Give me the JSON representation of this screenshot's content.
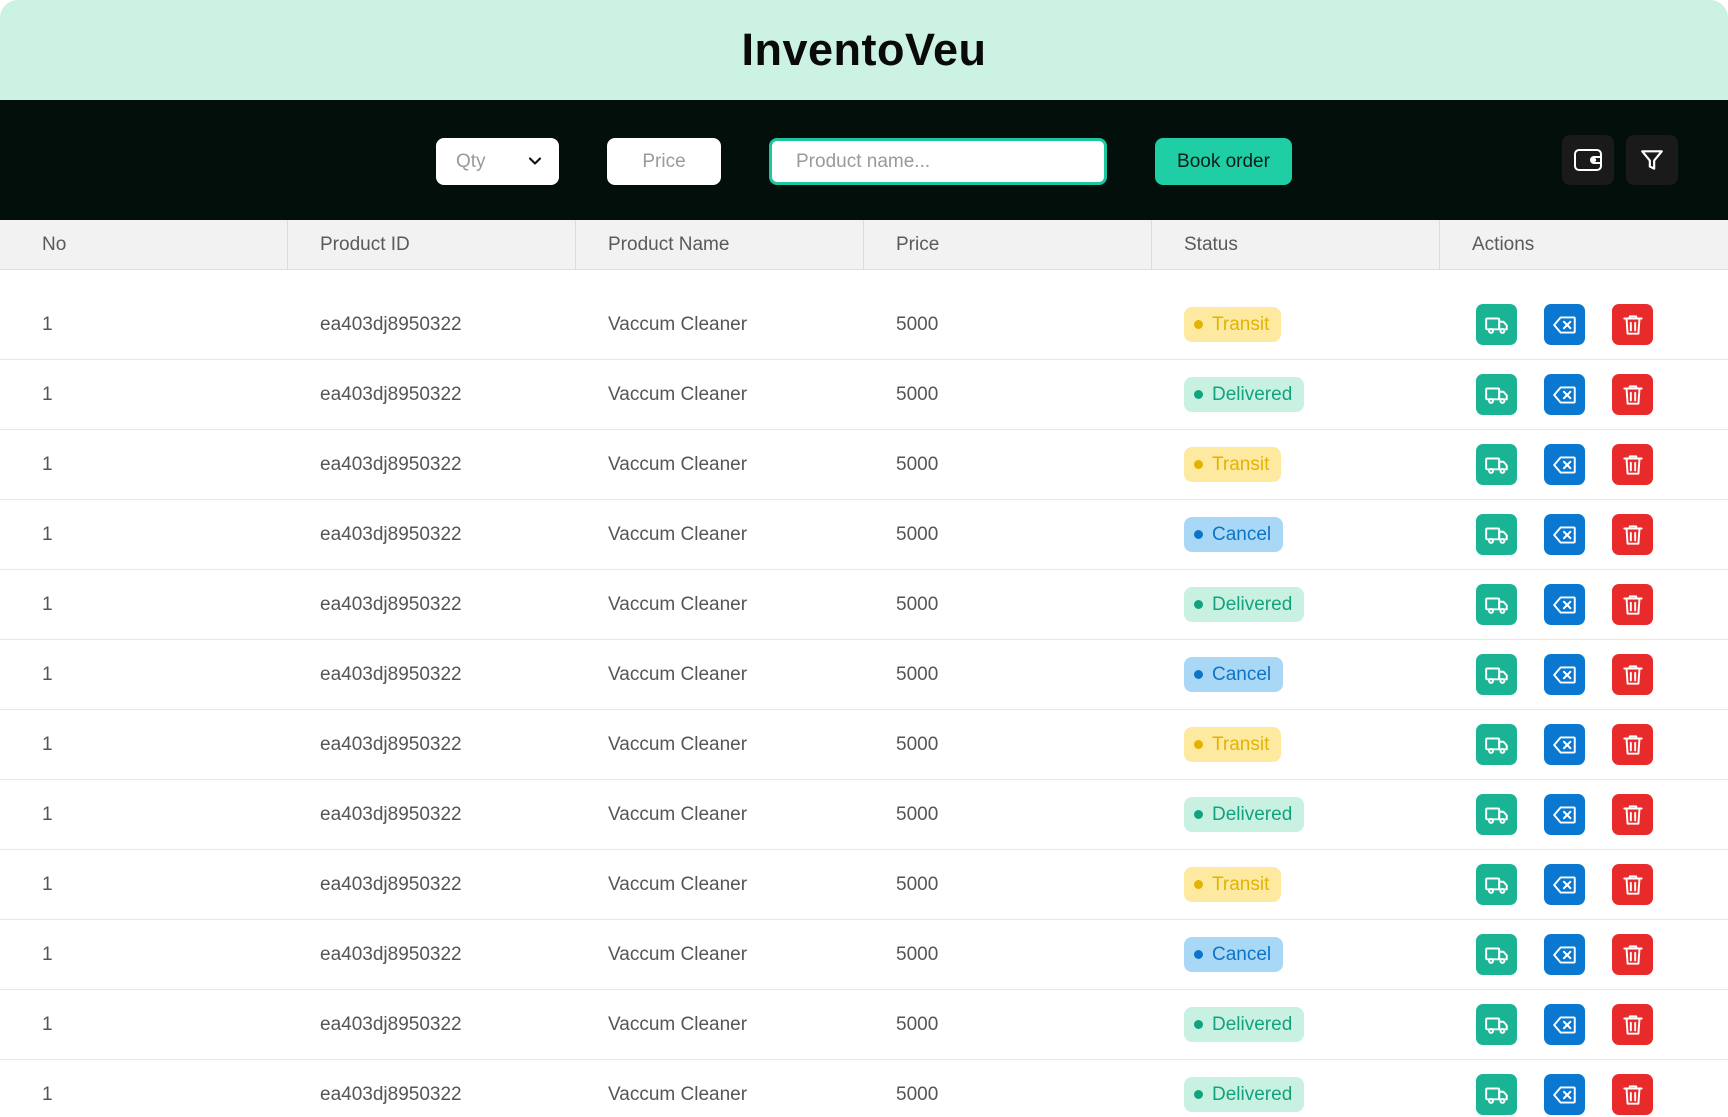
{
  "app": {
    "title": "InventoVeu"
  },
  "toolbar": {
    "qty_label": "Qty",
    "price_placeholder": "Price",
    "search_placeholder": "Product name...",
    "book_label": "Book order",
    "icons": [
      "wallet-icon",
      "filter-icon",
      "chevron-down-icon"
    ]
  },
  "table": {
    "headers": [
      "No",
      "Product ID",
      "Product Name",
      "Price",
      "Status",
      "Actions"
    ],
    "rows": [
      {
        "no": "1",
        "product_id": "ea403dj8950322",
        "product_name": "Vaccum Cleaner",
        "price": "5000",
        "status": "Transit"
      },
      {
        "no": "1",
        "product_id": "ea403dj8950322",
        "product_name": "Vaccum Cleaner",
        "price": "5000",
        "status": "Delivered"
      },
      {
        "no": "1",
        "product_id": "ea403dj8950322",
        "product_name": "Vaccum Cleaner",
        "price": "5000",
        "status": "Transit"
      },
      {
        "no": "1",
        "product_id": "ea403dj8950322",
        "product_name": "Vaccum Cleaner",
        "price": "5000",
        "status": "Cancel"
      },
      {
        "no": "1",
        "product_id": "ea403dj8950322",
        "product_name": "Vaccum Cleaner",
        "price": "5000",
        "status": "Delivered"
      },
      {
        "no": "1",
        "product_id": "ea403dj8950322",
        "product_name": "Vaccum Cleaner",
        "price": "5000",
        "status": "Cancel"
      },
      {
        "no": "1",
        "product_id": "ea403dj8950322",
        "product_name": "Vaccum Cleaner",
        "price": "5000",
        "status": "Transit"
      },
      {
        "no": "1",
        "product_id": "ea403dj8950322",
        "product_name": "Vaccum Cleaner",
        "price": "5000",
        "status": "Delivered"
      },
      {
        "no": "1",
        "product_id": "ea403dj8950322",
        "product_name": "Vaccum Cleaner",
        "price": "5000",
        "status": "Transit"
      },
      {
        "no": "1",
        "product_id": "ea403dj8950322",
        "product_name": "Vaccum Cleaner",
        "price": "5000",
        "status": "Cancel"
      },
      {
        "no": "1",
        "product_id": "ea403dj8950322",
        "product_name": "Vaccum Cleaner",
        "price": "5000",
        "status": "Delivered"
      },
      {
        "no": "1",
        "product_id": "ea403dj8950322",
        "product_name": "Vaccum Cleaner",
        "price": "5000",
        "status": "Delivered"
      }
    ],
    "row_action_icons": [
      "truck-icon",
      "backspace-icon",
      "trash-icon"
    ]
  },
  "colors": {
    "header_bg": "#ccf2e3",
    "toolbar_bg": "#020f0b",
    "accent": "#1fcea5",
    "transit": "#e4b200",
    "delivered": "#12a37e",
    "cancel": "#0e74c7",
    "delete": "#e82a2a"
  }
}
